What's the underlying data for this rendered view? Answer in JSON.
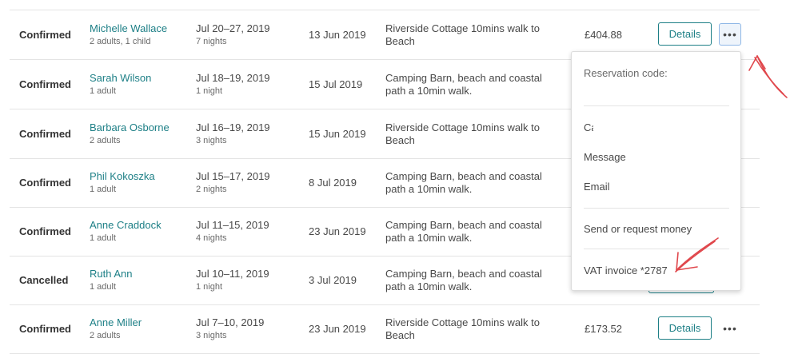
{
  "reservations": [
    {
      "status": "Confirmed",
      "guest": "Michelle Wallace",
      "guests_sub": "2 adults, 1 child",
      "dates": "Jul 20–27, 2019",
      "nights": "7 nights",
      "booked": "13 Jun 2019",
      "listing": "Riverside Cottage 10mins walk to Beach",
      "payout": "£404.88",
      "details_label": "Details",
      "more_label": "•••"
    },
    {
      "status": "Confirmed",
      "guest": "Sarah Wilson",
      "guests_sub": "1 adult",
      "dates": "Jul 18–19, 2019",
      "nights": "1 night",
      "booked": "15 Jul 2019",
      "listing": "Camping Barn, beach and coastal path a 10min walk.",
      "payout": "",
      "details_label": "",
      "more_label": ""
    },
    {
      "status": "Confirmed",
      "guest": "Barbara Osborne",
      "guests_sub": "2 adults",
      "dates": "Jul 16–19, 2019",
      "nights": "3 nights",
      "booked": "15 Jun 2019",
      "listing": "Riverside Cottage 10mins walk to Beach",
      "payout": "",
      "details_label": "",
      "more_label": ""
    },
    {
      "status": "Confirmed",
      "guest": "Phil Kokoszka",
      "guests_sub": "1 adult",
      "dates": "Jul 15–17, 2019",
      "nights": "2 nights",
      "booked": "8 Jul 2019",
      "listing": "Camping Barn, beach and coastal path a 10min walk.",
      "payout": "",
      "details_label": "",
      "more_label": ""
    },
    {
      "status": "Confirmed",
      "guest": "Anne Craddock",
      "guests_sub": "1 adult",
      "dates": "Jul 11–15, 2019",
      "nights": "4 nights",
      "booked": "23 Jun 2019",
      "listing": "Camping Barn, beach and coastal path a 10min walk.",
      "payout": "",
      "details_label": "",
      "more_label": ""
    },
    {
      "status": "Cancelled",
      "guest": "Ruth Ann",
      "guests_sub": "1 adult",
      "dates": "Jul 10–11, 2019",
      "nights": "1 night",
      "booked": "3 Jul 2019",
      "listing": "Camping Barn, beach and coastal path a 10min walk.",
      "payout": "",
      "details_label": "",
      "more_label": ""
    },
    {
      "status": "Confirmed",
      "guest": "Anne Miller",
      "guests_sub": "2 adults",
      "dates": "Jul 7–10, 2019",
      "nights": "3 nights",
      "booked": "23 Jun 2019",
      "listing": "Riverside Cottage 10mins walk to Beach",
      "payout": "£173.52",
      "details_label": "Details",
      "more_label": "•••"
    }
  ],
  "menu": {
    "reservation_code_label": "Reservation code:",
    "truncated_item": "Ca",
    "message": "Message",
    "email": "Email",
    "send_money": "Send or request money",
    "vat_invoice": "VAT invoice *2787"
  },
  "colors": {
    "link": "#1d7f86",
    "annotation": "#e0474c"
  }
}
